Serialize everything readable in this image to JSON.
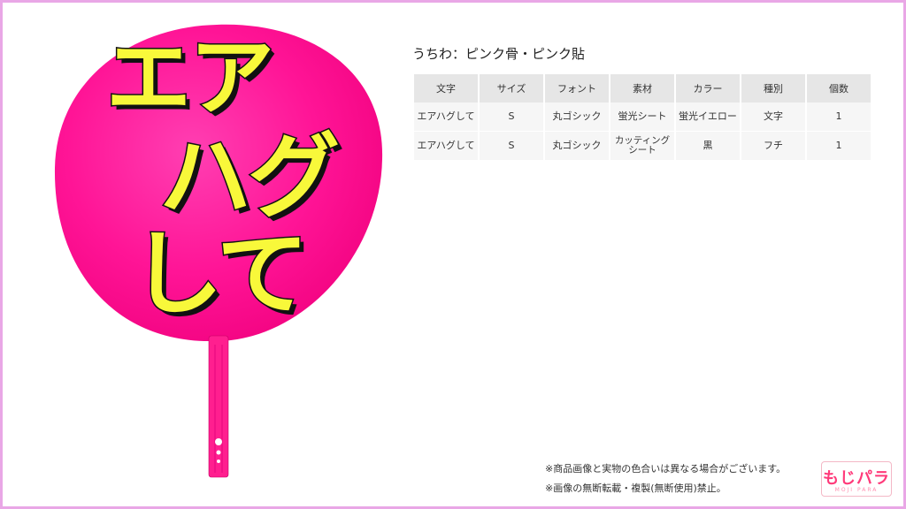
{
  "fan": {
    "line1": "エア",
    "line2": "ハグ",
    "line3": "して",
    "colors": {
      "face": "#ff1493",
      "handle": "#ff1f8f",
      "text": "#f8f83a",
      "outline": "#111111"
    }
  },
  "spec": {
    "title": "うちわ：ピンク骨・ピンク貼",
    "headers": [
      "文字",
      "サイズ",
      "フォント",
      "素材",
      "カラー",
      "種別",
      "個数"
    ],
    "rows": [
      [
        "エアハグして",
        "S",
        "丸ゴシック",
        "蛍光シート",
        "蛍光イエロー",
        "文字",
        "1"
      ],
      [
        "エアハグして",
        "S",
        "丸ゴシック",
        "カッティングシート",
        "黒",
        "フチ",
        "1"
      ]
    ]
  },
  "notes": {
    "line1": "※商品画像と実物の色合いは異なる場合がございます。",
    "line2": "※画像の無断転載・複製(無断使用)禁止。"
  },
  "logo": {
    "main": "もじパラ",
    "sub": "MOJI PARA"
  }
}
